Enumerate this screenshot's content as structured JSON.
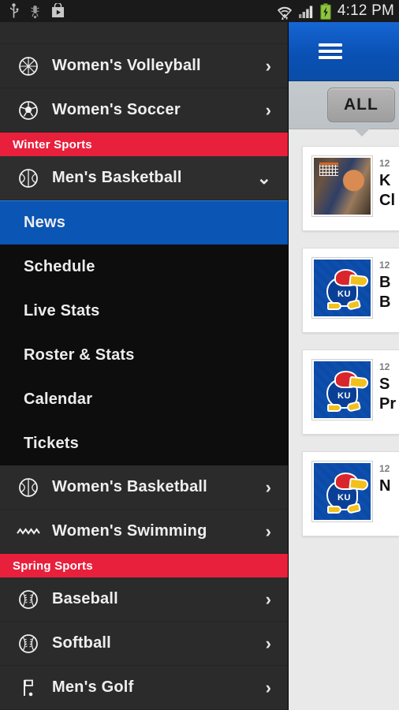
{
  "status_bar": {
    "icons_left": [
      "usb-icon",
      "debug-icon",
      "play-store-icon"
    ],
    "icons_right": [
      "wifi-icon",
      "signal-icon",
      "battery-charging-icon"
    ],
    "time": "4:12 PM"
  },
  "content": {
    "menu_icon": "hamburger-icon",
    "filter": {
      "label": "ALL"
    },
    "cards": [
      {
        "date": "12",
        "line1": "K",
        "line2": "Cl",
        "thumb": "basketball-photo"
      },
      {
        "date": "12",
        "line1": "B",
        "line2": "B",
        "thumb": "ku-jayhawk-logo"
      },
      {
        "date": "12",
        "line1": "S",
        "line2": "Pr",
        "thumb": "ku-jayhawk-logo"
      },
      {
        "date": "12",
        "line1": "N",
        "line2": "",
        "thumb": "ku-jayhawk-logo"
      }
    ]
  },
  "drawer": {
    "items": [
      {
        "type": "item",
        "label": "Women's Volleyball",
        "icon": "volleyball-icon",
        "chevron": "›"
      },
      {
        "type": "item",
        "label": "Women's Soccer",
        "icon": "soccer-ball-icon",
        "chevron": "›"
      },
      {
        "type": "section",
        "label": "Winter Sports"
      },
      {
        "type": "expandable",
        "label": "Men's Basketball",
        "icon": "basketball-icon",
        "chevron": "⌄"
      },
      {
        "type": "item",
        "label": "Women's Basketball",
        "icon": "basketball-icon",
        "chevron": "›"
      },
      {
        "type": "item",
        "label": "Women's Swimming",
        "icon": "swimming-waves-icon",
        "chevron": "›"
      },
      {
        "type": "section",
        "label": "Spring Sports"
      },
      {
        "type": "item",
        "label": "Baseball",
        "icon": "baseball-icon",
        "chevron": "›"
      },
      {
        "type": "item",
        "label": "Softball",
        "icon": "softball-icon",
        "chevron": "›"
      },
      {
        "type": "item",
        "label": "Men's Golf",
        "icon": "golf-flag-icon",
        "chevron": "›"
      }
    ],
    "submenu": [
      {
        "label": "News",
        "active": true
      },
      {
        "label": "Schedule",
        "active": false
      },
      {
        "label": "Live Stats",
        "active": false
      },
      {
        "label": "Roster & Stats",
        "active": false
      },
      {
        "label": "Calendar",
        "active": false
      },
      {
        "label": "Tickets",
        "active": false
      }
    ]
  },
  "colors": {
    "accent_blue": "#0b55b5",
    "header_blue": "#0a51b5",
    "section_red": "#e8203c",
    "drawer_bg": "#2b2b2b",
    "submenu_bg": "#0d0d0d"
  }
}
